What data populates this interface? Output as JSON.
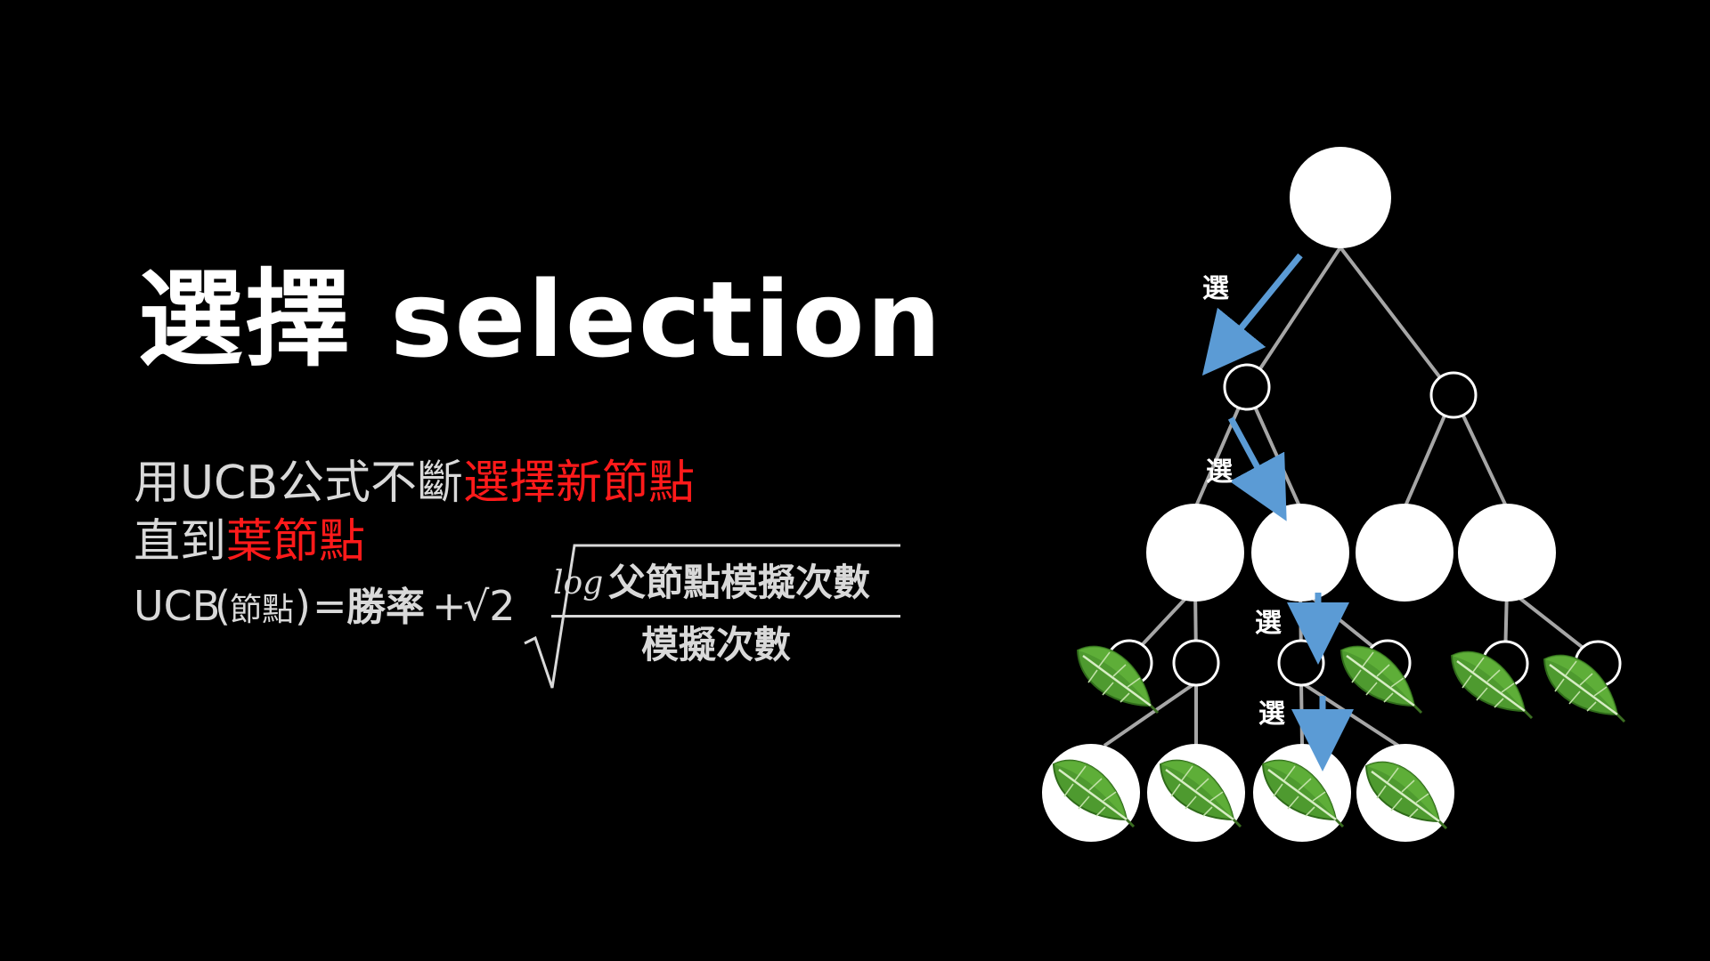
{
  "slide": {
    "title": "選擇 selection",
    "description": {
      "line1_prefix": "用UCB公式不斷",
      "line1_highlight": "選擇新節點",
      "line2_prefix": "直到",
      "line2_highlight": "葉節點"
    },
    "formula": {
      "lhs": "UCB",
      "lhs_arg": "節點",
      "equals": "=",
      "term1": "勝率",
      "plus": "+",
      "sqrt2": "√2",
      "numerator_log": "log",
      "numerator_text": "父節點模擬次數",
      "denominator_text": "模擬次數"
    }
  },
  "diagram": {
    "arrow_label": "選",
    "arrow_labels": [
      "選",
      "選",
      "選",
      "選"
    ],
    "colors": {
      "background": "#000000",
      "node_fill": "#ffffff",
      "edge": "#a6a6a6",
      "arrow": "#5b9bd5",
      "highlight_text": "#ff1a1a",
      "leaf_green": "#4e9a2f"
    },
    "icons": [
      "leaf-icon"
    ]
  }
}
